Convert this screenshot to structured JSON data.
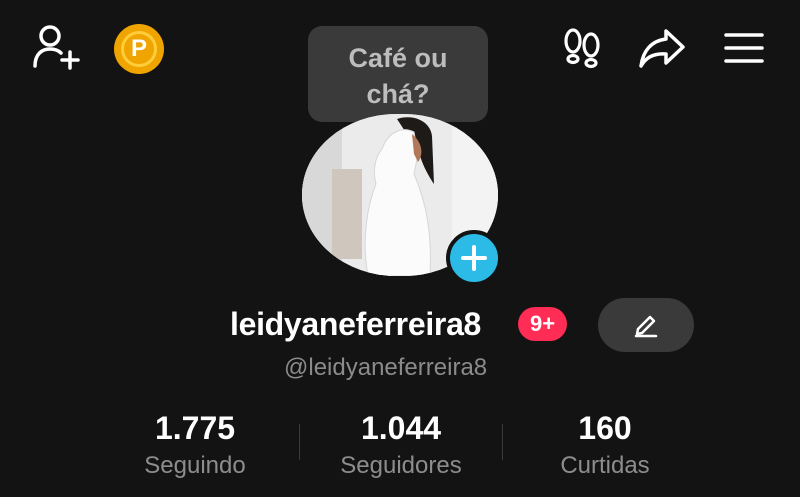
{
  "top_bar": {
    "add_friend_icon": "person-add-icon",
    "coin_label": "P",
    "coin_color": "#f0a400",
    "footprints_icon": "footprints-icon",
    "share_icon": "share-arrow-icon",
    "menu_icon": "hamburger-menu-icon"
  },
  "tooltip": {
    "line1": "Café ou",
    "line2": "chá?"
  },
  "profile": {
    "username": "leidyaneferreira8",
    "notification_badge": "9+",
    "badge_color": "#ff2d55",
    "handle": "@leidyaneferreira8",
    "avatar_add_color": "#2bbbe6"
  },
  "stats": [
    {
      "value": "1.775",
      "label": "Seguindo"
    },
    {
      "value": "1.044",
      "label": "Seguidores"
    },
    {
      "value": "160",
      "label": "Curtidas"
    }
  ]
}
